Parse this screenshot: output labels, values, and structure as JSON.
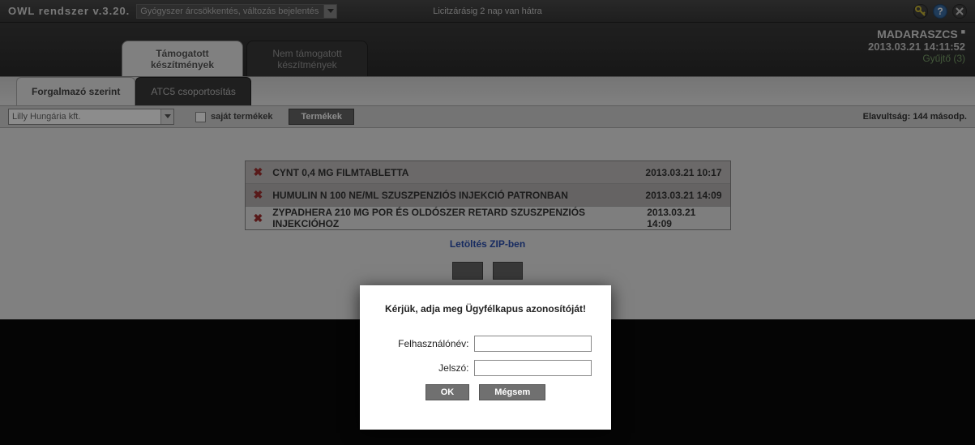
{
  "topbar": {
    "title": "OWL rendszer v.3.20.",
    "dropdown_label": "Gyógyszer árcsökkentés, változás bejelentés",
    "center_message": "Licitzárásig 2 nap van hátra"
  },
  "user": {
    "name": "MADARASZCS",
    "timestamp": "2013.03.21 14:11:52",
    "gyujto": "Gyűjtő (3)"
  },
  "bigtabs": {
    "active": "Támogatott\nkészítmények",
    "inactive": "Nem támogatott\nkészítmények"
  },
  "subtabs": {
    "active": "Forgalmazó szerint",
    "inactive": "ATC5 csoportosítás"
  },
  "filter": {
    "combo": "Lilly Hungária kft.",
    "checkbox_label": "saját termékek",
    "button": "Termékek",
    "stale": "Elavultság: 144 másodp."
  },
  "rows": [
    {
      "name": "CYNT 0,4 MG FILMTABLETTA",
      "time": "2013.03.21 10:17"
    },
    {
      "name": "HUMULIN N 100 NE/ML SZUSZPENZIÓS INJEKCIÓ PATRONBAN",
      "time": "2013.03.21 14:09"
    },
    {
      "name": "ZYPADHERA 210 MG POR ÉS OLDÓSZER RETARD SZUSZPENZIÓS INJEKCIÓHOZ",
      "time": "2013.03.21 14:09"
    }
  ],
  "ziplink": "Letöltés ZIP-ben",
  "modal": {
    "title": "Kérjük, adja meg Ügyfélkapus azonosítóját!",
    "user_label": "Felhasználónév:",
    "pass_label": "Jelszó:",
    "ok": "OK",
    "cancel": "Mégsem"
  }
}
